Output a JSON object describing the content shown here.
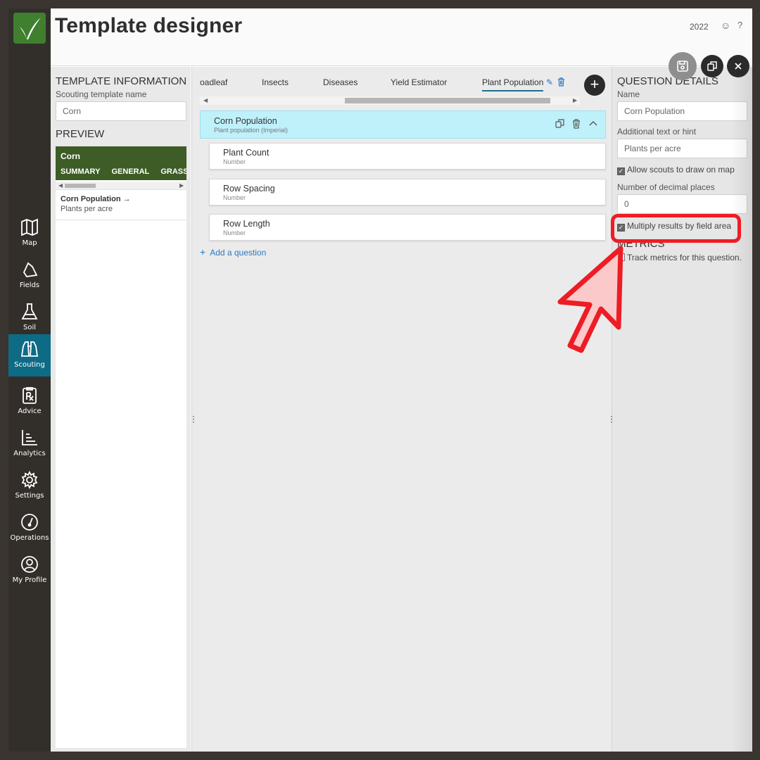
{
  "header": {
    "title": "Template designer",
    "year": "2022",
    "smiley_icon": "smiley-icon",
    "help_icon": "help-icon"
  },
  "nav": {
    "items": [
      {
        "label": "Map",
        "icon": "map-icon"
      },
      {
        "label": "Fields",
        "icon": "field-icon"
      },
      {
        "label": "Soil",
        "icon": "flask-icon"
      },
      {
        "label": "Scouting",
        "icon": "binoculars-icon",
        "active": true
      },
      {
        "label": "Advice",
        "icon": "prescription-icon"
      },
      {
        "label": "Analytics",
        "icon": "bar-chart-icon"
      },
      {
        "label": "Settings",
        "icon": "gear-icon"
      },
      {
        "label": "Operations",
        "icon": "gauge-icon"
      },
      {
        "label": "My Profile",
        "icon": "user-icon"
      }
    ]
  },
  "template_info": {
    "heading": "TEMPLATE INFORMATION",
    "name_label": "Scouting template name",
    "name_value": "Corn"
  },
  "preview": {
    "heading": "PREVIEW",
    "crop": "Corn",
    "tabs": [
      "SUMMARY",
      "GENERAL",
      "GRASS W"
    ],
    "question_title": "Corn Population",
    "question_hint": "Plants per acre"
  },
  "tabs": [
    {
      "label": "oadleaf"
    },
    {
      "label": "Insects"
    },
    {
      "label": "Diseases"
    },
    {
      "label": "Yield Estimator"
    },
    {
      "label": "Plant Population",
      "active": true
    }
  ],
  "group": {
    "title": "Corn Population",
    "subtitle": "Plant population (Imperial)"
  },
  "sub_questions": [
    {
      "title": "Plant Count",
      "type": "Number"
    },
    {
      "title": "Row Spacing",
      "type": "Number"
    },
    {
      "title": "Row Length",
      "type": "Number"
    }
  ],
  "add_question_label": "Add a question",
  "question_details": {
    "heading": "QUESTION DETAILS",
    "name_label": "Name",
    "name_value": "Corn Population",
    "hint_label": "Additional text or hint",
    "hint_value": "Plants per acre",
    "draw_on_map_label": "Allow scouts to draw on map",
    "draw_on_map_checked": true,
    "decimals_label": "Number of decimal places",
    "decimals_value": "0",
    "multiply_label": "Multiply results by field area",
    "multiply_checked": true,
    "metrics_heading": "METRICS",
    "track_metrics_label": "Track metrics for this question.",
    "track_metrics_checked": false
  },
  "colors": {
    "accent": "#0e6b86",
    "preview_green": "#3d5c26",
    "selected_question": "#bff1fb",
    "annotation_red": "#ee1c25"
  }
}
